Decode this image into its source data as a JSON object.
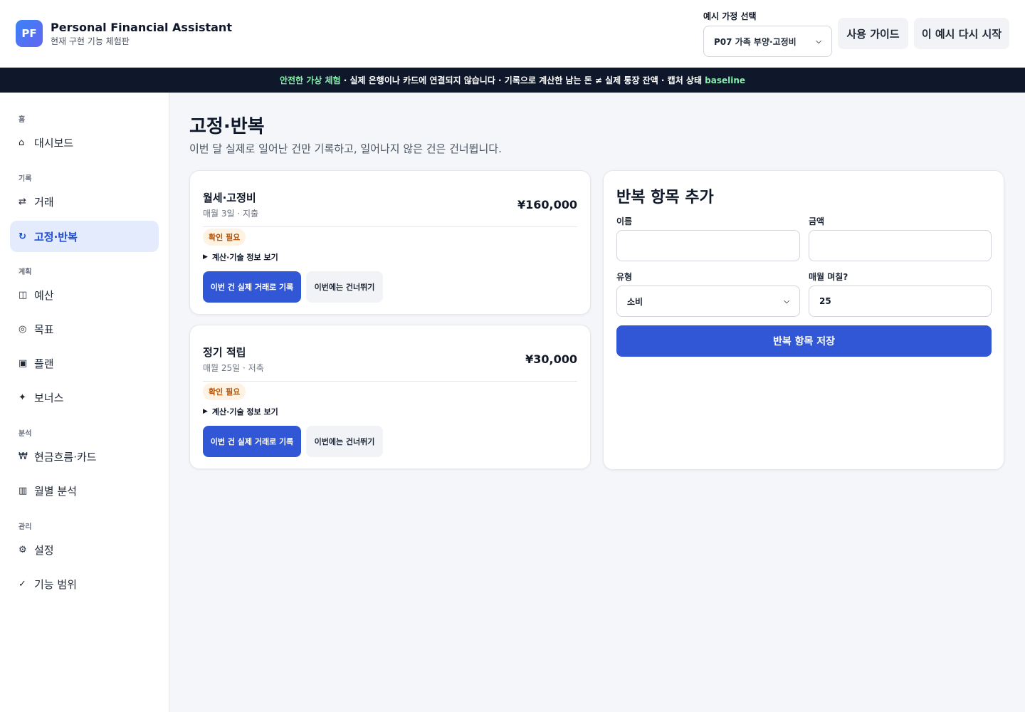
{
  "header": {
    "logo_text": "PF",
    "title": "Personal Financial Assistant",
    "subtitle": "현재 구현 기능 체험판",
    "scenario_label": "예시 가정 선택",
    "scenario_value": "P07 가족 부양·고정비",
    "guide_label": "사용 가이드",
    "restart_label": "이 예시 다시 시작"
  },
  "banner": {
    "highlight": "안전한 가상 체험",
    "text": " · 실제 은행이나 카드에 연결되지 않습니다 · 기록으로 계산한 남는 돈 ≠ 실제 통장 잔액 · 캡처 상태 ",
    "state": "baseline"
  },
  "sidebar": {
    "sections": {
      "home": "홈",
      "record": "기록",
      "plan": "계획",
      "analysis": "분석",
      "manage": "관리"
    },
    "items": [
      {
        "icon": "⌂",
        "label": "대시보드"
      },
      {
        "icon": "⇄",
        "label": "거래"
      },
      {
        "icon": "↻",
        "label": "고정·반복"
      },
      {
        "icon": "◫",
        "label": "예산"
      },
      {
        "icon": "◎",
        "label": "목표"
      },
      {
        "icon": "▣",
        "label": "플랜"
      },
      {
        "icon": "✦",
        "label": "보너스"
      },
      {
        "icon": "₩",
        "label": "현금흐름·카드"
      },
      {
        "icon": "▥",
        "label": "월별 분석"
      },
      {
        "icon": "⚙",
        "label": "설정"
      },
      {
        "icon": "✓",
        "label": "기능 범위"
      }
    ]
  },
  "main": {
    "title": "고정·반복",
    "description": "이번 달 실제로 일어난 건만 기록하고, 일어나지 않은 건은 건너뜁니다.",
    "items": [
      {
        "name": "월세·고정비",
        "meta": "매월 3일 · 지출",
        "amount": "¥160,000",
        "badge": "확인 필요",
        "details": "계산·기술 정보 보기",
        "record_label": "이번 건 실제 거래로 기록",
        "skip_label": "이번에는 건너뛰기"
      },
      {
        "name": "정기 적립",
        "meta": "매월 25일 · 저축",
        "amount": "¥30,000",
        "badge": "확인 필요",
        "details": "계산·기술 정보 보기",
        "record_label": "이번 건 실제 거래로 기록",
        "skip_label": "이번에는 건너뛰기"
      }
    ]
  },
  "form": {
    "title": "반복 항목 추가",
    "name_label": "이름",
    "name_value": "",
    "amount_label": "금액",
    "amount_value": "",
    "type_label": "유형",
    "type_value": "소비",
    "day_label": "매월 며칠?",
    "day_value": "25",
    "save_label": "반복 항목 저장"
  }
}
